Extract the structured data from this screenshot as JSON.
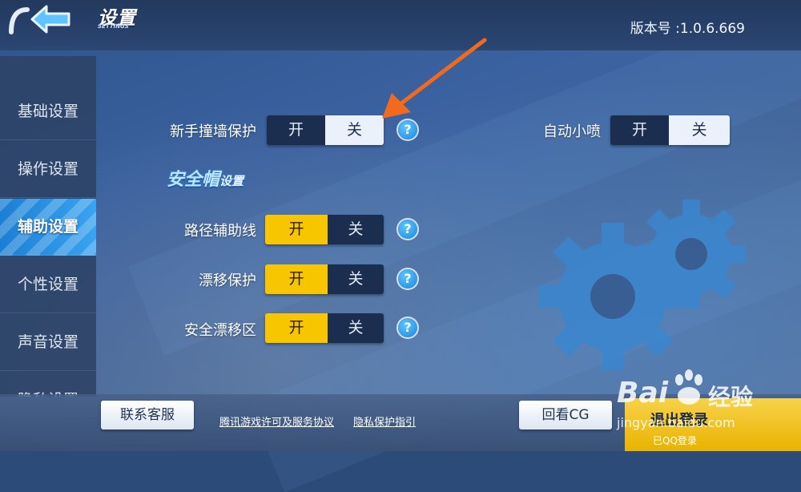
{
  "header": {
    "title": "设置",
    "subtitle": "SETTINGS",
    "version": "版本号 :1.0.6.669"
  },
  "sidebar": {
    "items": [
      {
        "label": "基础设置"
      },
      {
        "label": "操作设置"
      },
      {
        "label": "辅助设置"
      },
      {
        "label": "个性设置"
      },
      {
        "label": "声音设置"
      },
      {
        "label": "隐私设置"
      }
    ],
    "active": "辅助设置"
  },
  "settings": {
    "novice_wall": {
      "label": "新手撞墙保护",
      "on": "开",
      "off": "关",
      "selected": "关"
    },
    "auto_nitro": {
      "label": "自动小喷",
      "on": "开",
      "off": "关",
      "selected": "关"
    },
    "section": {
      "title": "安全帽",
      "suffix": "设置"
    },
    "path_guide": {
      "label": "路径辅助线",
      "on": "开",
      "off": "关",
      "selected": "开"
    },
    "drift_protect": {
      "label": "漂移保护",
      "on": "开",
      "off": "关",
      "selected": "开"
    },
    "safe_drift_zone": {
      "label": "安全漂移区",
      "on": "开",
      "off": "关",
      "selected": "开"
    },
    "help_glyph": "?"
  },
  "footer": {
    "contact": "联系客服",
    "license": "腾讯游戏许可及服务协议",
    "privacy": "隐私保护指引",
    "replay_cg": "回看CG",
    "logout": "退出登录",
    "logout_sub": "已QQ登录"
  },
  "watermark": {
    "brand": "Bai",
    "brand2": "经验",
    "url": "jingyan.baidu.com"
  },
  "colors": {
    "accent_blue": "#1b7fd4",
    "toggle_yellow": "#f7c600",
    "toggle_dark": "#1b2e4f",
    "arrow_orange": "#f26a1b"
  },
  "icons": [
    "back-arrow-icon",
    "help-icon",
    "gear-icon",
    "arrow-annotation-icon",
    "baidu-paw-icon"
  ]
}
